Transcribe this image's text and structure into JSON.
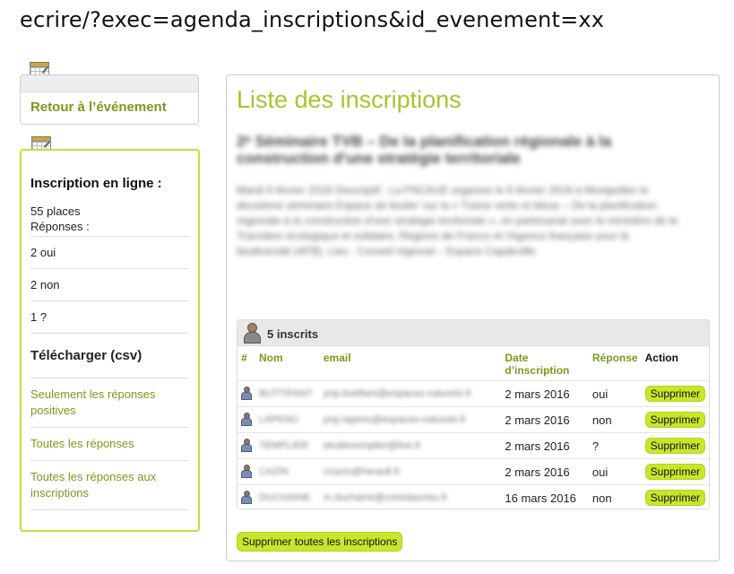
{
  "url": "ecrire/?exec=agenda_inscriptions&id_evenement=xx",
  "sidebar": {
    "back_link": "Retour à l’événement",
    "title": "Inscription en ligne :",
    "places": "55 places",
    "responses_label": "Réponses :",
    "yes": "2 oui",
    "no": "2 non",
    "maybe": "1  ?",
    "download_title": "Télécharger (csv)",
    "link_positive": "Seulement les réponses positives",
    "link_all": "Toutes les réponses",
    "link_all_inscriptions": "Toutes les réponses aux inscriptions"
  },
  "main": {
    "title": "Liste des inscriptions",
    "event_title": "2ᵉ Séminaire TVB – De la planification régionale à la construction d'une stratégie territoriale",
    "event_desc": "Mardi 6 février 2018 Descriptif : La FNCAUE organise le 6 février 2018 à Montpellier le deuxième séminaire Espace de biodiv' sur la « Trame verte et bleue – De la planification régionale à la construction d'une stratégie territoriale », en partenariat avec le ministère de la Transition écologique et solidaire, Régions de France et l'Agence française pour la biodiversité (AFB). Lieu : Conseil régional – Espace Capdeville",
    "count_label": "5 inscrits",
    "columns": {
      "num": "#",
      "nom": "Nom",
      "email": "email",
      "date": "Date d’inscription",
      "reponse": "Réponse",
      "action": "Action"
    },
    "rows": [
      {
        "nom": "BUTTIFANT",
        "email": "pnp.buttifant@espaces-naturels.fr",
        "date": "2 mars 2016",
        "reponse": "oui",
        "action": "Supprimer"
      },
      {
        "nom": "LAPENU",
        "email": "pnp.lapenu@espaces-naturels.fr",
        "date": "2 mars 2016",
        "reponse": "non",
        "action": "Supprimer"
      },
      {
        "nom": "TEMPLIER",
        "email": "etudiexemplier@live.fr",
        "date": "2 mars 2016",
        "reponse": "?",
        "action": "Supprimer"
      },
      {
        "nom": "CAZIN",
        "email": "ccazin@herault.fr",
        "date": "2 mars 2016",
        "reponse": "oui",
        "action": "Supprimer"
      },
      {
        "nom": "DUCHAINE",
        "email": "m.duchaine@conedaurieu.fr",
        "date": "16 mars 2016",
        "reponse": "non",
        "action": "Supprimer"
      }
    ],
    "delete_all": "Supprimer toutes les inscriptions"
  }
}
